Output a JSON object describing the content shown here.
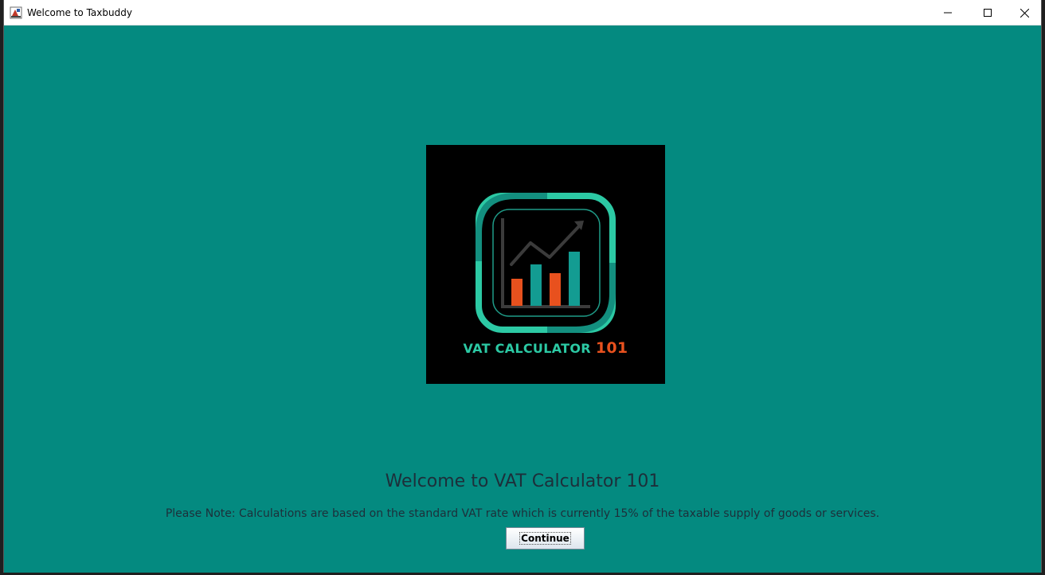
{
  "window": {
    "title": "Welcome to Taxbuddy",
    "background_color": "#048a80"
  },
  "logo": {
    "caption_main": "VAT CALCULATOR",
    "caption_number": "101",
    "accent_teal": "#2cc9a4",
    "accent_orange": "#e8511e",
    "icon": "bar-chart-growth-icon"
  },
  "main": {
    "welcome_title": "Welcome to VAT Calculator 101",
    "note": "Please Note: Calculations are based on the standard VAT rate which is currently 15% of the taxable supply of goods or services.",
    "continue_label": "Continue"
  }
}
